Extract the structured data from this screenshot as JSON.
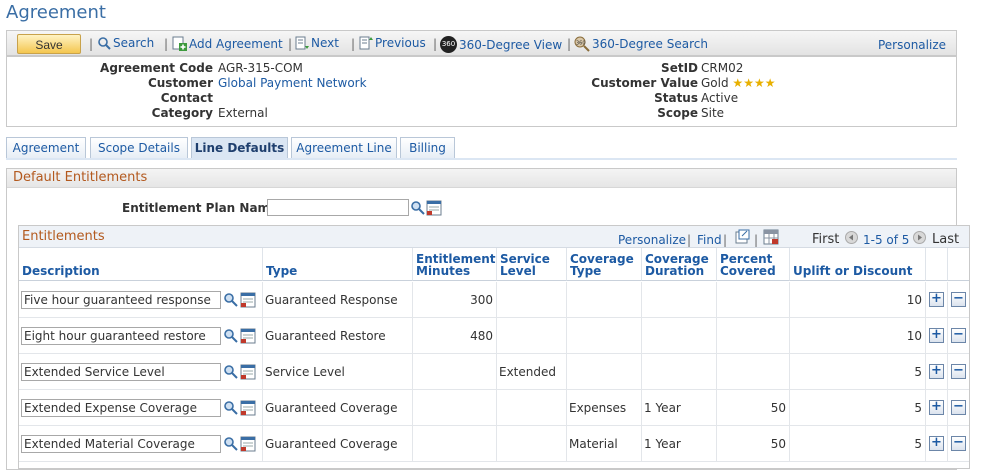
{
  "page": {
    "title": "Agreement"
  },
  "toolbar": {
    "save_label": "Save",
    "search_label": "Search",
    "add_agreement_label": "Add Agreement",
    "next_label": "Next",
    "previous_label": "Previous",
    "view_360_label": "360-Degree View",
    "search_360_label": "360-Degree Search",
    "personalize_label": "Personalize",
    "view_360_badge": "360"
  },
  "header": {
    "agreement_code_label": "Agreement Code",
    "agreement_code": "AGR-315-COM",
    "customer_label": "Customer",
    "customer": "Global Payment Network",
    "contact_label": "Contact",
    "contact": "",
    "category_label": "Category",
    "category": "External",
    "setid_label": "SetID",
    "setid": "CRM02",
    "customer_value_label": "Customer Value",
    "customer_value": "Gold",
    "customer_value_stars": 4,
    "status_label": "Status",
    "status": "Active",
    "scope_label": "Scope",
    "scope": "Site"
  },
  "tabs": [
    {
      "label": "Agreement",
      "active": false
    },
    {
      "label": "Scope Details",
      "active": false
    },
    {
      "label": "Line Defaults",
      "active": true
    },
    {
      "label": "Agreement Line",
      "active": false
    },
    {
      "label": "Billing",
      "active": false
    }
  ],
  "default_entitlements": {
    "title": "Default Entitlements",
    "plan_name_label": "Entitlement Plan Name",
    "plan_name_value": ""
  },
  "grid": {
    "title": "Entitlements",
    "personalize_label": "Personalize",
    "find_label": "Find",
    "first_label": "First",
    "range_label": "1-5 of 5",
    "last_label": "Last",
    "columns": [
      {
        "label": "Description"
      },
      {
        "label": "Type"
      },
      {
        "label": "Entitlement Minutes"
      },
      {
        "label": "Service Level"
      },
      {
        "label": "Coverage Type"
      },
      {
        "label": "Coverage Duration"
      },
      {
        "label": "Percent Covered"
      },
      {
        "label": "Uplift or Discount"
      }
    ],
    "rows": [
      {
        "description": "Five hour guaranteed response",
        "type": "Guaranteed Response",
        "minutes": "300",
        "service_level": "",
        "coverage_type": "",
        "coverage_duration": "",
        "percent": "",
        "uplift": "10"
      },
      {
        "description": "Eight hour guaranteed restore",
        "type": "Guaranteed Restore",
        "minutes": "480",
        "service_level": "",
        "coverage_type": "",
        "coverage_duration": "",
        "percent": "",
        "uplift": "10"
      },
      {
        "description": "Extended Service Level",
        "type": "Service Level",
        "minutes": "",
        "service_level": "Extended",
        "coverage_type": "",
        "coverage_duration": "",
        "percent": "",
        "uplift": "5"
      },
      {
        "description": "Extended Expense Coverage",
        "type": "Guaranteed Coverage",
        "minutes": "",
        "service_level": "",
        "coverage_type": "Expenses",
        "coverage_duration": "1 Year",
        "percent": "50",
        "uplift": "5"
      },
      {
        "description": "Extended Material Coverage",
        "type": "Guaranteed Coverage",
        "minutes": "",
        "service_level": "",
        "coverage_type": "Material",
        "coverage_duration": "1 Year",
        "percent": "50",
        "uplift": "5"
      }
    ]
  },
  "colors": {
    "link": "#1d5aa3",
    "section_title": "#b3591e",
    "page_title": "#3a6ea5"
  }
}
